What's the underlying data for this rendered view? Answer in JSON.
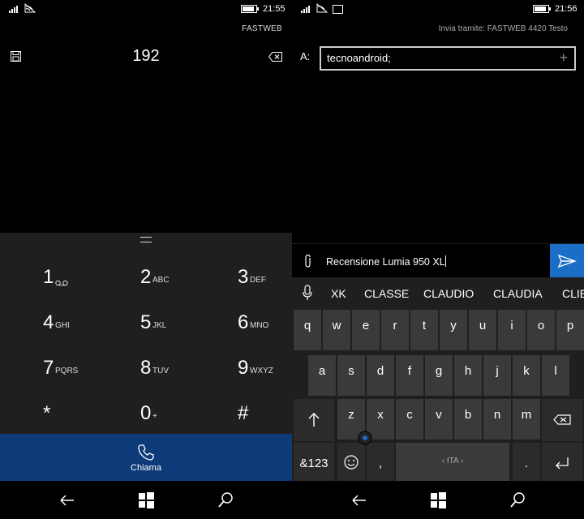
{
  "left": {
    "status": {
      "time": "21:55"
    },
    "carrier": "FASTWEB",
    "number": "192",
    "keys": [
      {
        "digit": "1",
        "letters": ""
      },
      {
        "digit": "2",
        "letters": "ABC"
      },
      {
        "digit": "3",
        "letters": "DEF"
      },
      {
        "digit": "4",
        "letters": "GHI"
      },
      {
        "digit": "5",
        "letters": "JKL"
      },
      {
        "digit": "6",
        "letters": "MNO"
      },
      {
        "digit": "7",
        "letters": "PQRS"
      },
      {
        "digit": "8",
        "letters": "TUV"
      },
      {
        "digit": "9",
        "letters": "WXYZ"
      },
      {
        "digit": "*",
        "letters": ""
      },
      {
        "digit": "0",
        "letters": "+"
      },
      {
        "digit": "#",
        "letters": ""
      }
    ],
    "call_label": "Chiama"
  },
  "right": {
    "status": {
      "time": "21:56"
    },
    "send_via": "Invia tramite: FASTWEB 4420 Testo",
    "to_label": "A:",
    "recipient": "tecnoandroid;",
    "plus": "+",
    "message": "Recensione Lumia 950 XL",
    "suggestions": [
      "XK",
      "CLASSE",
      "CLAUDIO",
      "CLAUDIA",
      "CLIE"
    ],
    "row1": [
      "q",
      "w",
      "e",
      "r",
      "t",
      "y",
      "u",
      "i",
      "o",
      "p"
    ],
    "row2": [
      "a",
      "s",
      "d",
      "f",
      "g",
      "h",
      "j",
      "k",
      "l"
    ],
    "row3": [
      "z",
      "x",
      "c",
      "v",
      "b",
      "n",
      "m"
    ],
    "symbols_key": "&123",
    "comma": ",",
    "space_label": "‹ ITA ›",
    "period": "."
  },
  "colors": {
    "accent": "#1a6ec6",
    "call_bar": "#0d3a78",
    "keypad_bg": "#1f1f1f",
    "key_bg": "#3a3a3a"
  },
  "battery_level": 0.9
}
